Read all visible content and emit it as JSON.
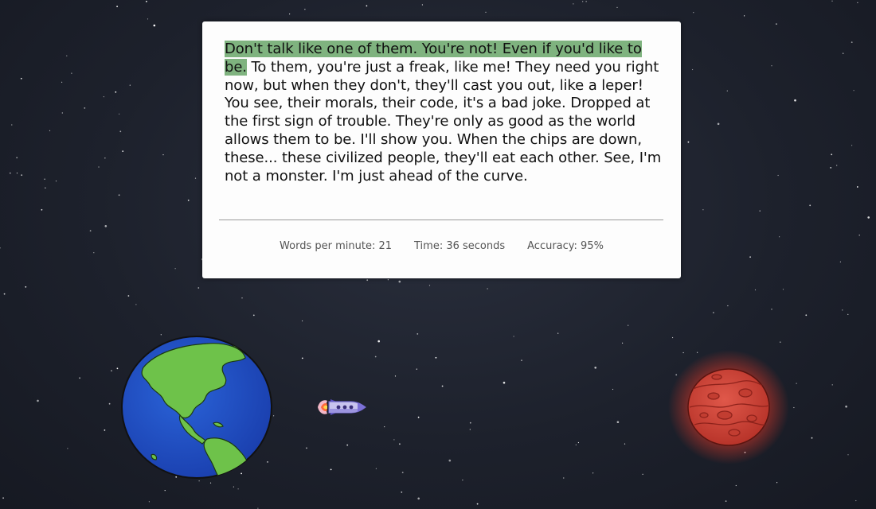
{
  "passage": {
    "typed_text": "Don't talk like one of them. You're not! Even if you'd like to be.",
    "remaining_text": " To them, you're just a freak, like me! They need you right now, but when they don't, they'll cast you out, like a leper! You see, their morals, their code, it's a bad joke. Dropped at the first sign of trouble. They're only as good as the world allows them to be. I'll show you. When the chips are down, these... these civilized people, they'll eat each other. See, I'm not a monster. I'm just ahead of the curve."
  },
  "stats": {
    "wpm_label": "Words per minute: 21",
    "time_label": "Time: 36 seconds",
    "accuracy_label": "Accuracy: 95%"
  },
  "progress": {
    "rocket_progress": 0.36
  },
  "colors": {
    "highlight": "#7fb37f",
    "background": "#1d212c",
    "earth_ocean": "#1f4fc4",
    "earth_land": "#6ec24a",
    "mars": "#d6473a"
  },
  "icons": {
    "start_planet": "earth-icon",
    "vehicle": "rocket-icon",
    "destination_planet": "mars-icon"
  }
}
